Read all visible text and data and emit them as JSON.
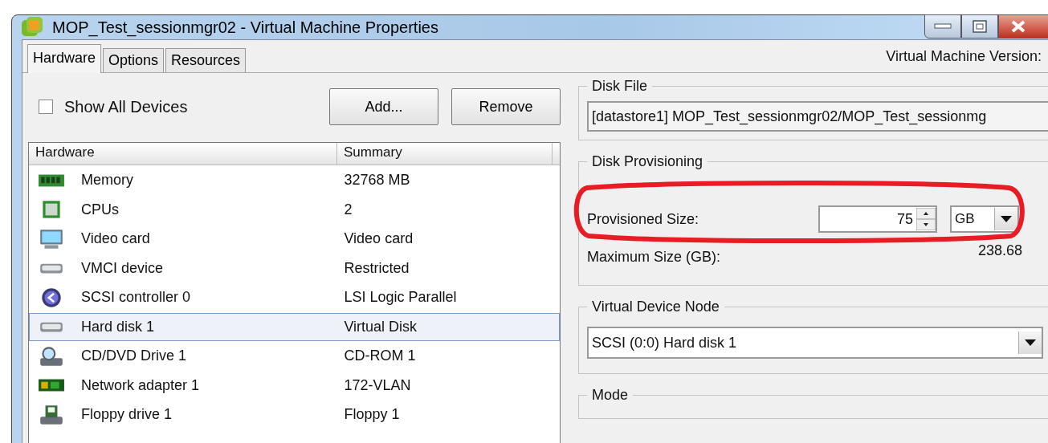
{
  "window": {
    "title": "MOP_Test_sessionmgr02 - Virtual Machine Properties"
  },
  "tabs": [
    {
      "label": "Hardware",
      "selected": true
    },
    {
      "label": "Options",
      "selected": false
    },
    {
      "label": "Resources",
      "selected": false
    }
  ],
  "version_label": "Virtual Machine Version:",
  "show_all_devices": {
    "label": "Show All Devices",
    "checked": false
  },
  "buttons": [
    "Add...",
    "Remove"
  ],
  "table": {
    "columns": [
      "Hardware",
      "Summary"
    ],
    "rows": [
      {
        "kind": "memory",
        "name": "Memory",
        "summary": "32768 MB",
        "selected": false
      },
      {
        "kind": "cpu",
        "name": "CPUs",
        "summary": "2",
        "selected": false
      },
      {
        "kind": "video",
        "name": "Video card",
        "summary": "Video card",
        "selected": false
      },
      {
        "kind": "vmci",
        "name": "VMCI device",
        "summary": "Restricted",
        "selected": false
      },
      {
        "kind": "scsi",
        "name": "SCSI controller 0",
        "summary": "LSI Logic Parallel",
        "selected": false
      },
      {
        "kind": "disk",
        "name": "Hard disk 1",
        "summary": "Virtual Disk",
        "selected": true
      },
      {
        "kind": "cdrom",
        "name": "CD/DVD Drive 1",
        "summary": "CD-ROM 1",
        "selected": false
      },
      {
        "kind": "network",
        "name": "Network adapter 1",
        "summary": "172-VLAN",
        "selected": false
      },
      {
        "kind": "floppy",
        "name": "Floppy drive 1",
        "summary": "Floppy 1",
        "selected": false
      }
    ]
  },
  "disk_file": {
    "title": "Disk File",
    "value": "[datastore1] MOP_Test_sessionmgr02/MOP_Test_sessionmg"
  },
  "disk_provisioning": {
    "title": "Disk Provisioning",
    "provisioned_size": {
      "label": "Provisioned Size:",
      "value": "75",
      "unit": "GB"
    },
    "maximum_size": {
      "label": "Maximum Size (GB):",
      "value": "238.68"
    }
  },
  "virtual_device_node": {
    "title": "Virtual Device Node",
    "value": "SCSI (0:0) Hard disk 1"
  },
  "mode": {
    "title": "Mode"
  }
}
